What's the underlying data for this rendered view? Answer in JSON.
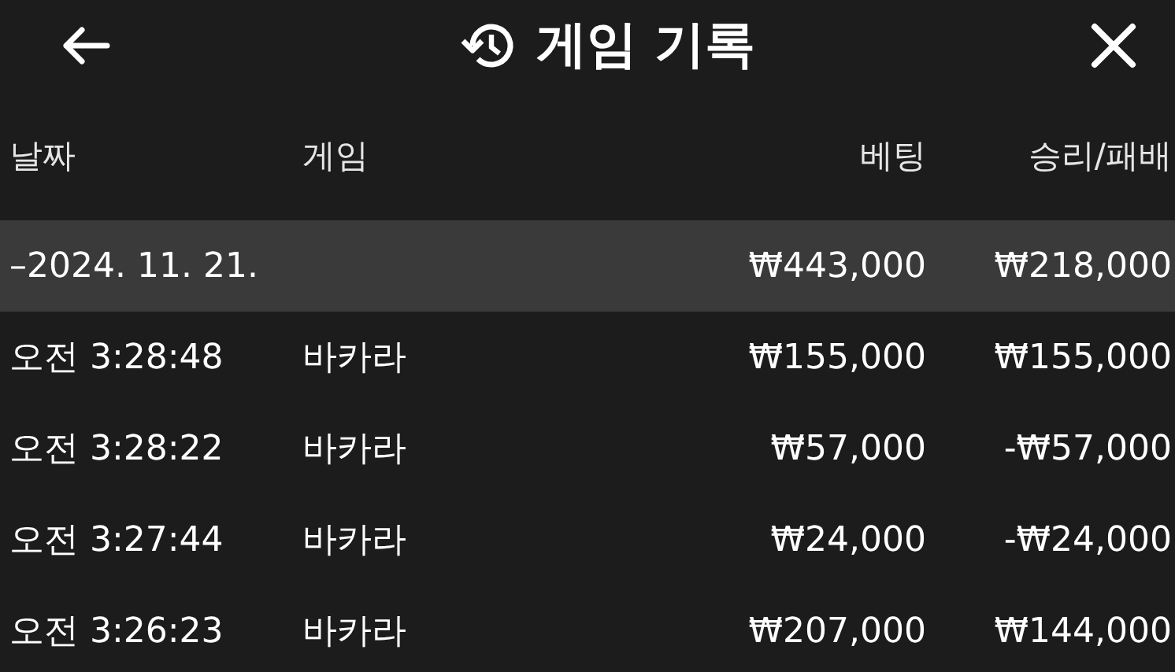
{
  "header": {
    "title": "게임 기록"
  },
  "columns": [
    "날짜",
    "게임",
    "베팅",
    "승리/패배"
  ],
  "group": {
    "toggle": "–",
    "date": "2024. 11. 21.",
    "bet": "₩443,000",
    "result": "₩218,000"
  },
  "rows": [
    {
      "time": "오전 3:28:48",
      "game": "바카라",
      "bet": "₩155,000",
      "result": "₩155,000"
    },
    {
      "time": "오전 3:28:22",
      "game": "바카라",
      "bet": "₩57,000",
      "result": "-₩57,000"
    },
    {
      "time": "오전 3:27:44",
      "game": "바카라",
      "bet": "₩24,000",
      "result": "-₩24,000"
    },
    {
      "time": "오전 3:26:23",
      "game": "바카라",
      "bet": "₩207,000",
      "result": "₩144,000"
    }
  ]
}
